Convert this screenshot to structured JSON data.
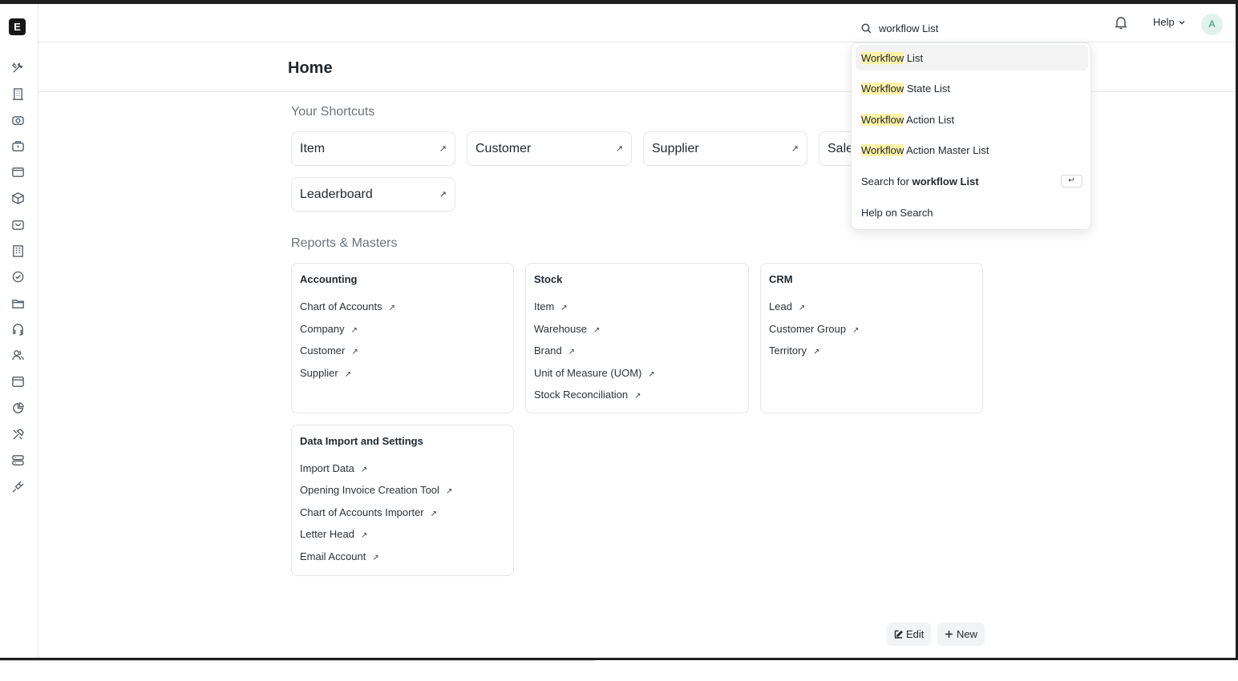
{
  "app": {
    "logo_letter": "E"
  },
  "sidebar": {
    "icons": [
      "tools-icon",
      "building-icon",
      "eye-icon",
      "briefcase-icon",
      "card-icon",
      "box-icon",
      "bag-icon",
      "office-icon",
      "badge-icon",
      "folder-icon",
      "headset-icon",
      "users-icon",
      "browser-icon",
      "pie-chart-icon",
      "hammer-icon",
      "server-icon",
      "plug-icon"
    ]
  },
  "navbar": {
    "search_value": "workflow List",
    "help_label": "Help",
    "avatar_letter": "A"
  },
  "page": {
    "title": "Home"
  },
  "shortcuts": {
    "title": "Your Shortcuts",
    "items": [
      "Item",
      "Customer",
      "Supplier",
      "Sales Invoice",
      "Leaderboard"
    ]
  },
  "reports": {
    "title": "Reports & Masters",
    "cards": [
      {
        "title": "Accounting",
        "links": [
          "Chart of Accounts",
          "Company",
          "Customer",
          "Supplier"
        ]
      },
      {
        "title": "Stock",
        "links": [
          "Item",
          "Warehouse",
          "Brand",
          "Unit of Measure (UOM)",
          "Stock Reconciliation"
        ]
      },
      {
        "title": "CRM",
        "links": [
          "Lead",
          "Customer Group",
          "Territory"
        ]
      },
      {
        "title": "Data Import and Settings",
        "links": [
          "Import Data",
          "Opening Invoice Creation Tool",
          "Chart of Accounts Importer",
          "Letter Head",
          "Email Account"
        ]
      }
    ]
  },
  "dropdown": {
    "results": [
      {
        "match": "Workflow",
        "rest": " List"
      },
      {
        "match": "Workflow",
        "rest": " State List"
      },
      {
        "match": "Workflow",
        "rest": " Action List"
      },
      {
        "match": "Workflow",
        "rest": " Action Master List"
      }
    ],
    "search_for_prefix": "Search for ",
    "search_for_term": "workflow List",
    "enter_key": "↵",
    "help_on_search": "Help on Search"
  },
  "footer": {
    "edit_label": "Edit",
    "new_label": "New"
  },
  "arrow_glyph": "↗"
}
